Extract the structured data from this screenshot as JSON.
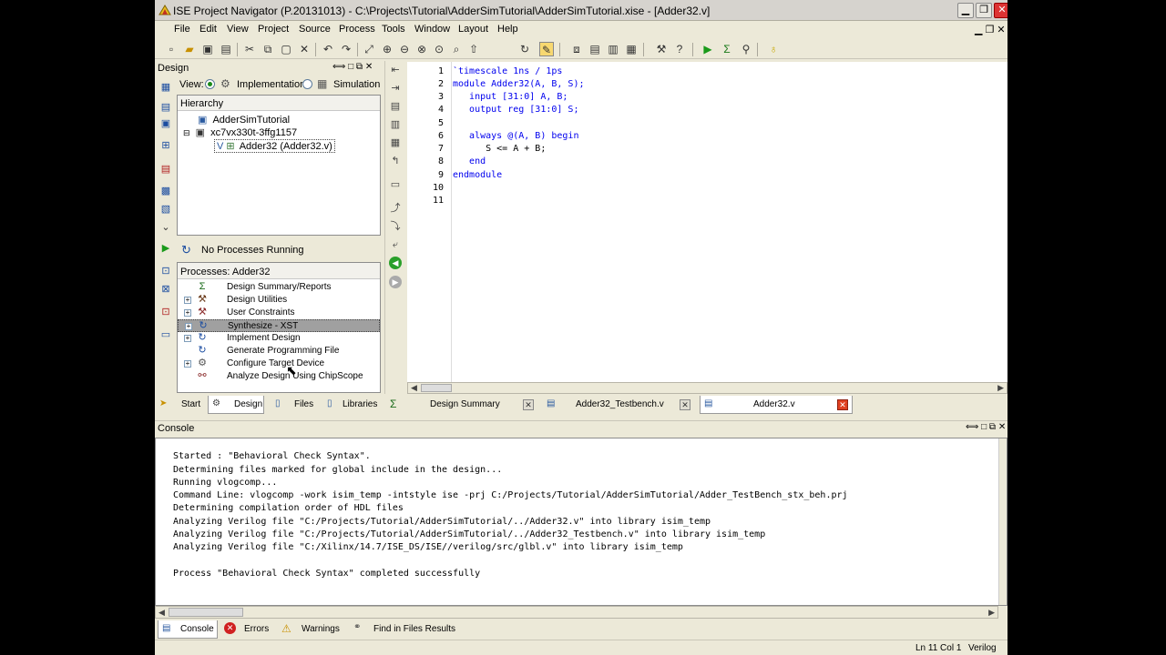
{
  "window": {
    "title": "ISE Project Navigator (P.20131013) - C:\\Projects\\Tutorial\\AdderSimTutorial\\AdderSimTutorial.xise - [Adder32.v]",
    "min": "▁",
    "max": "❐",
    "close": "✕"
  },
  "menu": [
    "File",
    "Edit",
    "View",
    "Project",
    "Source",
    "Process",
    "Tools",
    "Window",
    "Layout",
    "Help"
  ],
  "design_panel": {
    "title": "Design",
    "view_label": "View:",
    "view_options": [
      "Implementation",
      "Simulation"
    ],
    "hierarchy_header": "Hierarchy",
    "tree": [
      "AdderSimTutorial",
      "xc7vx330t-3ffg1157",
      "Adder32 (Adder32.v)"
    ],
    "status": "No Processes Running",
    "processes_header": "Processes: Adder32",
    "processes": [
      {
        "label": "Design Summary/Reports",
        "expandable": false
      },
      {
        "label": "Design Utilities",
        "expandable": true
      },
      {
        "label": "User Constraints",
        "expandable": true
      },
      {
        "label": "Synthesize - XST",
        "expandable": true,
        "selected": true
      },
      {
        "label": "Implement Design",
        "expandable": true
      },
      {
        "label": "Generate Programming File",
        "expandable": false
      },
      {
        "label": "Configure Target Device",
        "expandable": true
      },
      {
        "label": "Analyze Design Using ChipScope",
        "expandable": false
      }
    ]
  },
  "editor": {
    "line_numbers": [
      "1",
      "2",
      "3",
      "4",
      "5",
      "6",
      "7",
      "8",
      "9",
      "10",
      "11"
    ],
    "lines": [
      "`timescale 1ns / 1ps",
      "module Adder32(A, B, S);",
      "   input [31:0] A, B;",
      "   output reg [31:0] S;",
      "",
      "   always @(A, B) begin",
      "      S <= A + B;",
      "   end",
      "endmodule",
      "",
      ""
    ]
  },
  "left_tabs": [
    "Start",
    "Design",
    "Files",
    "Libraries"
  ],
  "doc_tabs": [
    "Design Summary",
    "Adder32_Testbench.v",
    "Adder32.v"
  ],
  "console": {
    "title": "Console",
    "lines": [
      "Started : \"Behavioral Check Syntax\".",
      "Determining files marked for global include in the design...",
      "Running vlogcomp...",
      "Command Line: vlogcomp -work isim_temp -intstyle ise -prj C:/Projects/Tutorial/AdderSimTutorial/Adder_TestBench_stx_beh.prj",
      "Determining compilation order of HDL files",
      "Analyzing Verilog file \"C:/Projects/Tutorial/AdderSimTutorial/../Adder32.v\" into library isim_temp",
      "Analyzing Verilog file \"C:/Projects/Tutorial/AdderSimTutorial/../Adder32_Testbench.v\" into library isim_temp",
      "Analyzing Verilog file \"C:/Xilinx/14.7/ISE_DS/ISE//verilog/src/glbl.v\" into library isim_temp",
      "",
      "Process \"Behavioral Check Syntax\" completed successfully"
    ]
  },
  "bottom_tabs": [
    "Console",
    "Errors",
    "Warnings",
    "Find in Files Results"
  ],
  "status_bar": {
    "position": "Ln 11 Col 1",
    "language": "Verilog"
  },
  "panel_controls": "⟺ □ ⧉ ✕",
  "colors": {
    "keyword": "#0000ee",
    "selected_row": "#a0a0a0",
    "chrome": "#ece9d8"
  }
}
